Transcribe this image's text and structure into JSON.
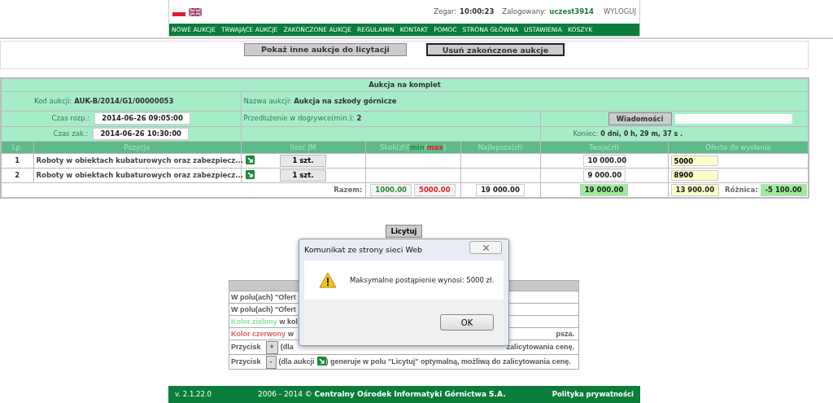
{
  "header": {
    "clock_label": "Zegar:",
    "clock": "10:00:23",
    "user_label": "Zalogowany:",
    "user": "uczest3914",
    "logout": "WYLOGUJ"
  },
  "nav": [
    "NOWE AUKCJE",
    "TRWAJĄCE AUKCJE",
    "ZAKOŃCZONE AUKCJE",
    "REGULAMIN",
    "KONTAKT",
    "POMOC",
    "STRONA GŁÓWNA",
    "USTAWIENIA",
    "KOSZYK"
  ],
  "actions": [
    {
      "label": "Pokaż inne aukcje do licytacji",
      "focused": false
    },
    {
      "label": "Usuń zakończone aukcje",
      "focused": true
    }
  ],
  "auction": {
    "title": "Aukcja na komplet",
    "code_label": "Kod aukcji:",
    "code": "AUK-B/2014/G1/00000053",
    "name_label": "Nazwa aukcji:",
    "name": "Aukcja na szkody górnicze",
    "start_label": "Czas rozp.:",
    "start": "2014-06-26 09:05:00",
    "extension_label": "Przedłużenie w dogrywce(min.):",
    "extension": "2",
    "messages_button": "Wiadomości",
    "end_label": "Czas zak.:",
    "end": "2014-06-26 10:30:00",
    "countdown_label": "Koniec:",
    "countdown": "0 dni, 0 h, 29 m, 37 s ."
  },
  "columns": [
    {
      "label": "Lp."
    },
    {
      "label": "Pozycja"
    },
    {
      "label": "Ilość JM"
    },
    {
      "label": "Skok(zł)[",
      "min": "min",
      "separator": "/",
      "max": "max",
      "suffix": "]"
    },
    {
      "label": "Najlepsza(zł)"
    },
    {
      "label": "Twoja(zł)"
    },
    {
      "label": "Oferta do wysłania"
    }
  ],
  "rows": [
    {
      "lp": "1",
      "position": "Roboty w obiektach kubaturowych oraz zabezpiecz...",
      "quantity": "1 szt.",
      "yours": "10 000.00",
      "offer": "5000"
    },
    {
      "lp": "2",
      "position": "Roboty w obiektach kubaturowych oraz zabezpiecz...",
      "quantity": "1 szt.",
      "yours": "9 000.00",
      "offer": "8900"
    }
  ],
  "totals": {
    "label": "Razem:",
    "min": "1000.00",
    "max": "5000.00",
    "best": "19 000.00",
    "yours": "19 000.00",
    "offer": "13 900.00",
    "diff_label": "Różnica:",
    "diff": "-5 100.00"
  },
  "bid_button": "Licytuj",
  "legend": [
    {
      "left": [
        {
          "kind": "text",
          "text": "W polu(ach) \"Ofert"
        }
      ]
    },
    {
      "left": [
        {
          "kind": "text",
          "text": "W polu(ach) \"Ofert"
        }
      ]
    },
    {
      "left": [
        {
          "kind": "green",
          "text": "Kolor zielony"
        },
        {
          "kind": "text",
          "text": "w kol"
        }
      ]
    },
    {
      "left": [
        {
          "kind": "red",
          "text": "Kolor czerwony"
        },
        {
          "kind": "text",
          "text": "w"
        }
      ],
      "right": [
        {
          "kind": "text",
          "text": "psza."
        }
      ]
    },
    {
      "left": [
        {
          "kind": "text",
          "text": "Przycisk"
        },
        {
          "kind": "key",
          "text": "+"
        },
        {
          "kind": "text",
          "text": "(dla"
        }
      ],
      "right": [
        {
          "kind": "text",
          "text": "zalicytowania cenę."
        }
      ]
    },
    {
      "left": [
        {
          "kind": "text",
          "text": "Przycisk"
        },
        {
          "kind": "key",
          "text": "-"
        },
        {
          "kind": "text",
          "text": "(dla aukcji"
        },
        {
          "kind": "icon"
        },
        {
          "kind": "text",
          "text": ") generuje w polu \"Licytuj\" optymalną, możliwą do zalicytowania cenę."
        }
      ]
    }
  ],
  "dialog": {
    "title": "Komunikat ze strony sieci Web",
    "message": "Maksymalne postąpienie wynosi: 5000 zł.",
    "ok": "OK"
  },
  "footer": {
    "version": "v. 2.1.22.0",
    "copyright": "2006 - 2014 © **Centralny Ośrodek Informatyki Górnictwa S.A.**",
    "privacy": "Polityka prywatności"
  }
}
